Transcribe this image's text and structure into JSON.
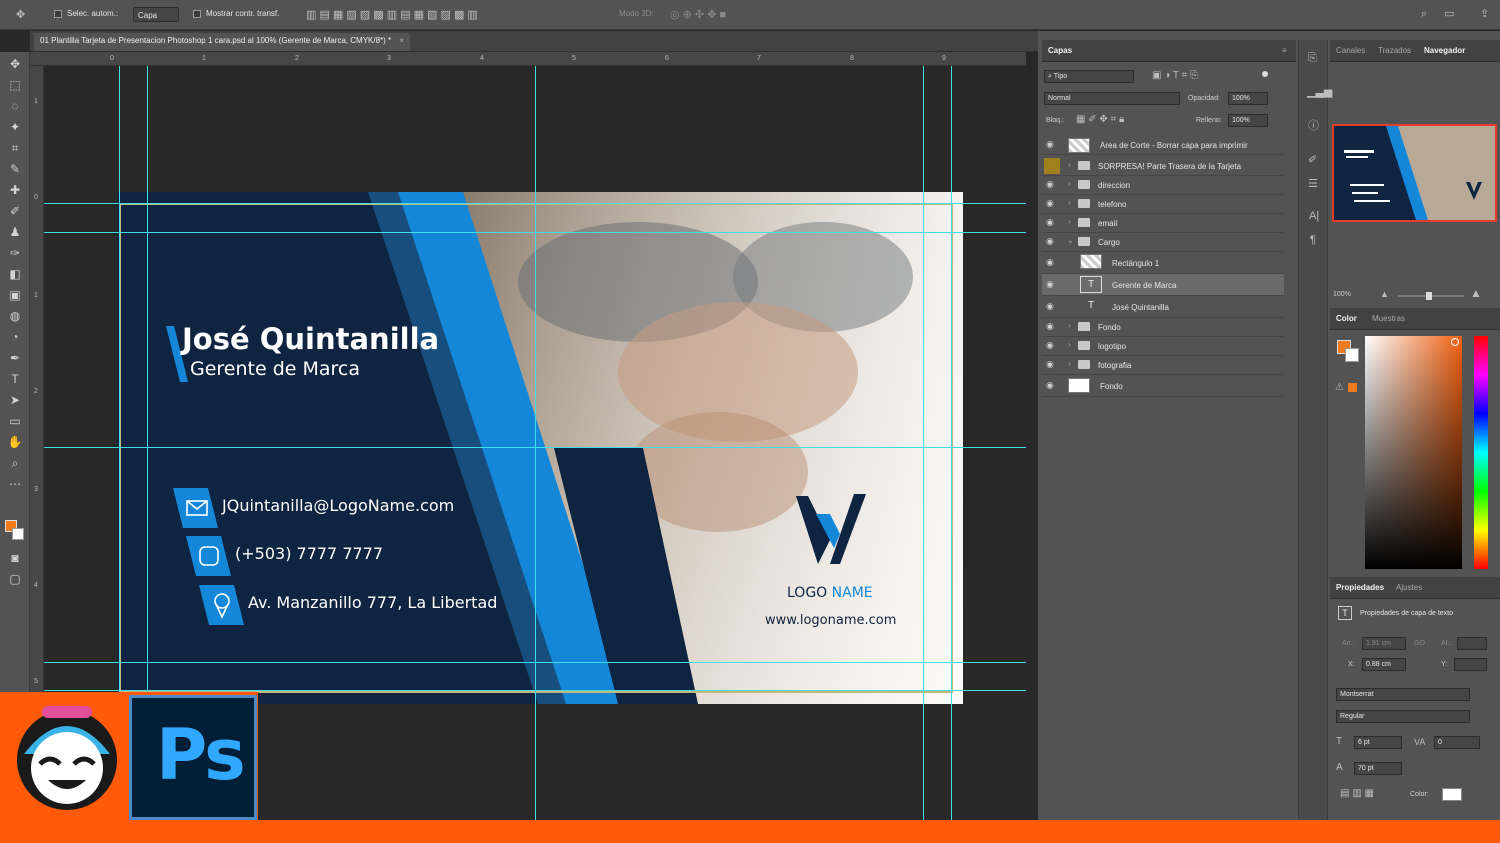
{
  "options_bar": {
    "auto_select_label": "Selec. autom.:",
    "auto_select_value": "Capa",
    "show_transform_label": "Mostrar contr. transf.",
    "mode3d_label": "Modo 3D:"
  },
  "document": {
    "tab_title": "01 Plantilla Tarjeta de Presentacion Photoshop 1 cara.psd al 100% (Gerente de Marca, CMYK/8*) *",
    "ruler_top": [
      "0",
      "1",
      "2",
      "3",
      "4",
      "5",
      "6",
      "7",
      "8",
      "9"
    ],
    "ruler_left": [
      "1",
      "0",
      "1",
      "2",
      "3",
      "4",
      "5"
    ]
  },
  "card": {
    "name": "José Quintanilla",
    "role": "Gerente de Marca",
    "email": "JQuintanilla@LogoName.com",
    "phone": "(+503) 7777 7777",
    "address": "Av. Manzanillo 777, La Libertad",
    "logo_text_a": "LOGO",
    "logo_text_b": "NAME",
    "website": "www.logoname.com",
    "colors": {
      "navy": "#0f2440",
      "blue": "#1487d9",
      "accent": "#2a9df4"
    }
  },
  "layers_panel": {
    "tab": "Capas",
    "filter": "Tipo",
    "blend_mode": "Normal",
    "opacity_label": "Opacidad:",
    "opacity_value": "100%",
    "lock_label": "Bloq.:",
    "fill_label": "Relleno:",
    "fill_value": "100%",
    "layers": [
      {
        "name": "Area de Corte - Borrar capa para imprimir",
        "type": "thumb"
      },
      {
        "name": "SORPRESA! Parte Trasera de la Tarjeta",
        "type": "folder"
      },
      {
        "name": "direccion",
        "type": "folder"
      },
      {
        "name": "telefono",
        "type": "folder"
      },
      {
        "name": "email",
        "type": "folder"
      },
      {
        "name": "Cargo",
        "type": "folder-open"
      },
      {
        "name": "Rectángulo 1",
        "type": "shape"
      },
      {
        "name": "Gerente de Marca",
        "type": "text"
      },
      {
        "name": "José Quintanilla",
        "type": "text"
      },
      {
        "name": "Fondo",
        "type": "folder"
      },
      {
        "name": "logotipo",
        "type": "folder"
      },
      {
        "name": "fotografia",
        "type": "folder"
      },
      {
        "name": "Fondo",
        "type": "fill"
      }
    ]
  },
  "navigator": {
    "tabs": [
      "Canales",
      "Trazados",
      "Navegador"
    ],
    "zoom": "100%"
  },
  "color_panel": {
    "tabs": [
      "Color",
      "Muestras"
    ],
    "foreground": "#f07a1e"
  },
  "properties": {
    "tabs": [
      "Propiedades",
      "Ajustes"
    ],
    "heading": "Propiedades de capa de texto",
    "w_label": "An.:",
    "w_value": "1.91 cm",
    "go_label": "GO",
    "h_label": "Al.:",
    "x_label": "X:",
    "x_value": "0.88 cm",
    "y_label": "Y:",
    "font": "Montserrat",
    "style": "Regular",
    "size": "6 pt",
    "tracking": "0",
    "leading": "70 pt",
    "color_label": "Color:"
  },
  "brand": {
    "ps_label": "Ps"
  }
}
